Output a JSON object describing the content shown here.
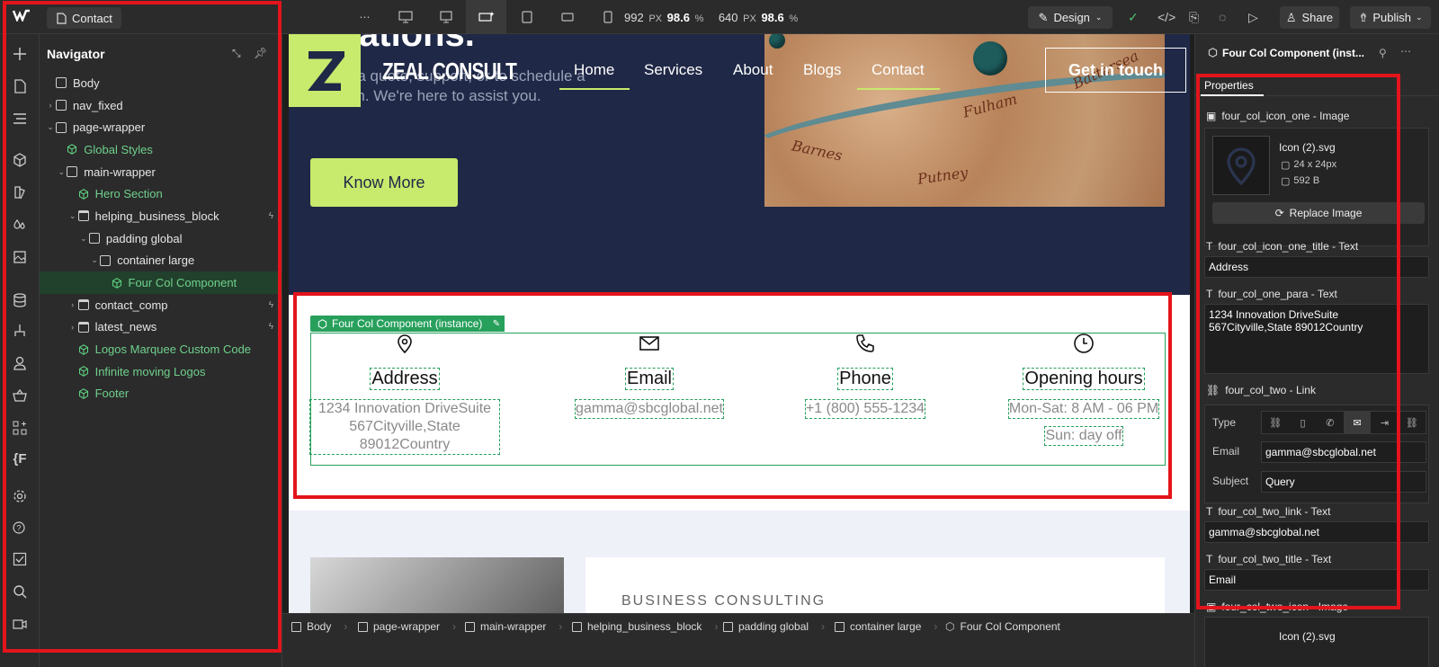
{
  "topbar": {
    "page_name": "Contact",
    "width": "992",
    "width_unit": "PX",
    "width_pct": "98.6",
    "pct1": "%",
    "height": "640",
    "height_unit": "PX",
    "height_pct": "98.6",
    "pct2": "%",
    "mode": "Design",
    "share": "Share",
    "publish": "Publish"
  },
  "navigator": {
    "title": "Navigator",
    "items": [
      {
        "label": "Body",
        "indent": 0,
        "kind": "box",
        "caret": ""
      },
      {
        "label": "nav_fixed",
        "indent": 0,
        "kind": "box",
        "caret": "›"
      },
      {
        "label": "page-wrapper",
        "indent": 0,
        "kind": "box",
        "caret": "⌄"
      },
      {
        "label": "Global Styles",
        "indent": 1,
        "kind": "component",
        "caret": ""
      },
      {
        "label": "main-wrapper",
        "indent": 1,
        "kind": "box",
        "caret": "⌄"
      },
      {
        "label": "Hero Section",
        "indent": 2,
        "kind": "component",
        "caret": ""
      },
      {
        "label": "helping_business_block",
        "indent": 2,
        "kind": "section",
        "caret": "⌄",
        "bolt": true
      },
      {
        "label": "padding global",
        "indent": 3,
        "kind": "box",
        "caret": "⌄"
      },
      {
        "label": "container large",
        "indent": 4,
        "kind": "box",
        "caret": "⌄"
      },
      {
        "label": "Four Col Component",
        "indent": 5,
        "kind": "component",
        "caret": "",
        "selected": true
      },
      {
        "label": "contact_comp",
        "indent": 2,
        "kind": "section",
        "caret": "›",
        "bolt": true
      },
      {
        "label": "latest_news",
        "indent": 2,
        "kind": "section",
        "caret": "›",
        "bolt": true
      },
      {
        "label": "Logos Marquee Custom Code",
        "indent": 2,
        "kind": "component",
        "caret": ""
      },
      {
        "label": "Infinite moving Logos",
        "indent": 2,
        "kind": "component",
        "caret": ""
      },
      {
        "label": "Footer",
        "indent": 2,
        "kind": "component",
        "caret": ""
      }
    ]
  },
  "site": {
    "hero_heading_fragment": "ations.",
    "hero_text": "out a quote, support, or to schedule a\nation. We're here to assist you.",
    "brand": "ZEAL CONSULT",
    "menu": [
      "Home",
      "Services",
      "About",
      "Blogs",
      "Contact"
    ],
    "cta": "Get in touch",
    "know_more": "Know More",
    "map_labels": [
      "Barnes",
      "Fulham",
      "Putney",
      "Battersea"
    ],
    "instance_tag": "Four Col Component (instance)",
    "columns": [
      {
        "icon": "location-pin-icon",
        "title": "Address",
        "para": "1234 Innovation DriveSuite 567Cityville,State 89012Country"
      },
      {
        "icon": "mail-icon",
        "title": "Email",
        "para": "gamma@sbcglobal.net"
      },
      {
        "icon": "phone-icon",
        "title": "Phone",
        "para": "+1 (800) 555-1234"
      },
      {
        "icon": "clock-icon",
        "title": "Opening hours",
        "para": "Mon-Sat: 8 AM - 06 PM",
        "para2": "Sun: day off"
      }
    ],
    "eyebrow": "BUSINESS CONSULTING"
  },
  "breadcrumbs": [
    "Body",
    "page-wrapper",
    "main-wrapper",
    "helping_business_block",
    "padding global",
    "container large",
    "Four Col Component"
  ],
  "properties": {
    "title": "Four Col Component (inst...",
    "tab": "Properties",
    "image_label": "four_col_icon_one - Image",
    "image_name": "Icon (2).svg",
    "image_dims": "24 x 24px",
    "image_size": "592 B",
    "replace": "Replace Image",
    "icon_title_label": "four_col_icon_one_title - Text",
    "icon_title_value": "Address",
    "one_para_label": "four_col_one_para - Text",
    "one_para_value": "1234 Innovation DriveSuite 567Cityville,State 89012Country",
    "two_link_label": "four_col_two - Link",
    "type_label": "Type",
    "email_label": "Email",
    "email_value": "gamma@sbcglobal.net",
    "subject_label": "Subject",
    "subject_value": "Query",
    "two_link_text_label": "four_col_two_link - Text",
    "two_link_text_value": "gamma@sbcglobal.net",
    "two_title_label": "four_col_two_title - Text",
    "two_title_value": "Email",
    "two_icon_label": "four_col_two_icon - Image",
    "two_icon_name": "Icon (2).svg"
  },
  "colors": {
    "accent_green": "#27a05c",
    "brand_lime": "#c8ea6d",
    "hero_navy": "#1f2846",
    "highlight_red": "#e3141b"
  }
}
